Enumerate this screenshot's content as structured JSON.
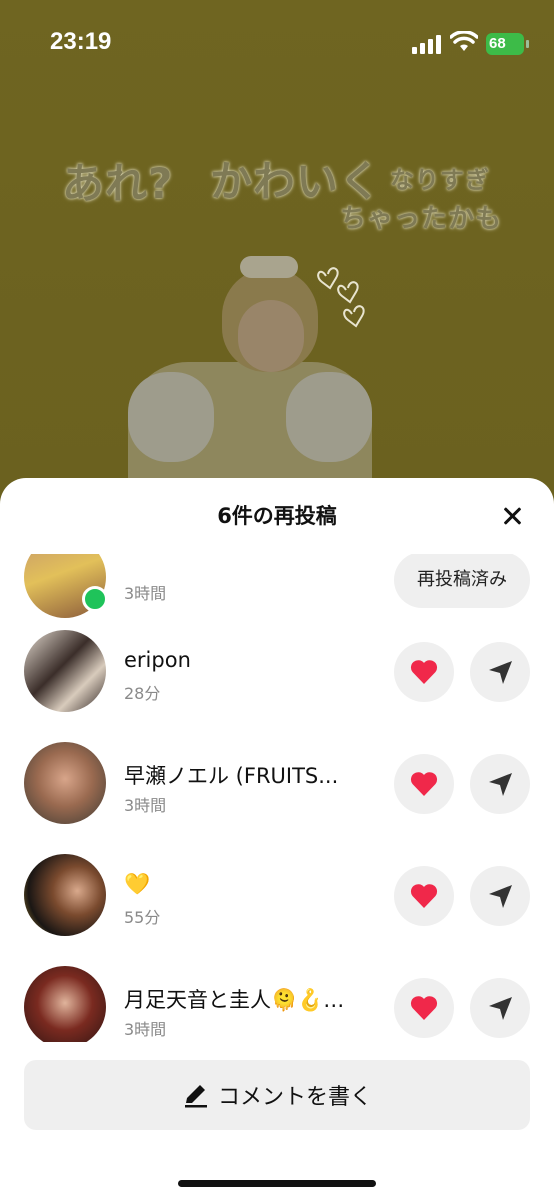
{
  "status_bar": {
    "time": "23:19",
    "battery": "68"
  },
  "background": {
    "text_1": "あれ?",
    "text_2": "かわいく",
    "text_3": "なりすぎ",
    "text_4": "ちゃったかも"
  },
  "sheet": {
    "title": "6件の再投稿",
    "rows": [
      {
        "name": "",
        "time": "3時間",
        "action": "再投稿済み"
      },
      {
        "name": "eripon",
        "time": "28分"
      },
      {
        "name": "早瀬ノエル (FRUITS...",
        "time": "3時間"
      },
      {
        "name": "💛",
        "time": "55分"
      },
      {
        "name": "月足天音と圭人🫠🪝…",
        "time": "3時間"
      }
    ],
    "comment_button": "コメントを書く"
  },
  "colors": {
    "like": "#f0284a",
    "online": "#1fc35a",
    "battery": "#3dbb48"
  },
  "icons": {
    "close": "close-icon",
    "heart": "heart-icon",
    "share": "send-icon",
    "pen": "pen-icon"
  }
}
